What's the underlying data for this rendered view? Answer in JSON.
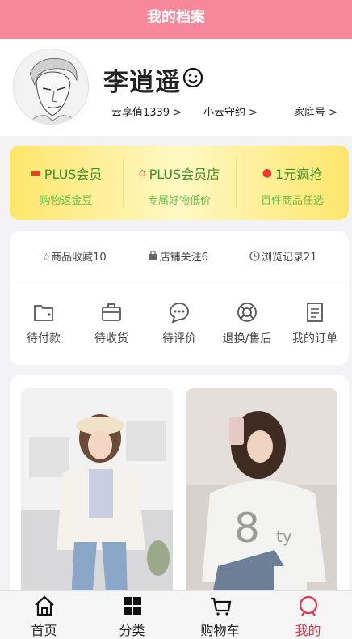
{
  "header": {
    "title": "我的档案"
  },
  "profile": {
    "name": "李逍遥",
    "stats": [
      "云享值1339 >",
      "小云守约 >",
      "家庭号 >"
    ]
  },
  "plus": [
    {
      "title": "PLUS会员",
      "subtitle": "购物返金豆",
      "icon": "monitor-icon"
    },
    {
      "title": "PLUS会员店",
      "subtitle": "专属好物低价",
      "icon": "home-icon"
    },
    {
      "title": "1元疯抢",
      "subtitle": "百件商品任选",
      "icon": "balloon-icon"
    }
  ],
  "orders": {
    "header": [
      "☆商品收藏10",
      "店铺关注6",
      "浏览记录21"
    ],
    "items": [
      {
        "label": "待付款",
        "icon": "wallet-icon"
      },
      {
        "label": "待收货",
        "icon": "briefcase-icon"
      },
      {
        "label": "待评价",
        "icon": "chat-icon"
      },
      {
        "label": "退换/售后",
        "icon": "lifebuoy-icon"
      },
      {
        "label": "我的订单",
        "icon": "document-icon"
      }
    ]
  },
  "tabbar": {
    "items": [
      {
        "label": "首页",
        "icon": "home-icon"
      },
      {
        "label": "分类",
        "icon": "grid-icon"
      },
      {
        "label": "购物车",
        "icon": "cart-icon"
      },
      {
        "label": "我的",
        "icon": "user-icon"
      }
    ],
    "active_index": 3
  },
  "colors": {
    "header_bg": "#f7879a",
    "plus_gold": "#fde66c",
    "plus_text": "#3f8f2d",
    "active_tab": "#e8304c"
  }
}
